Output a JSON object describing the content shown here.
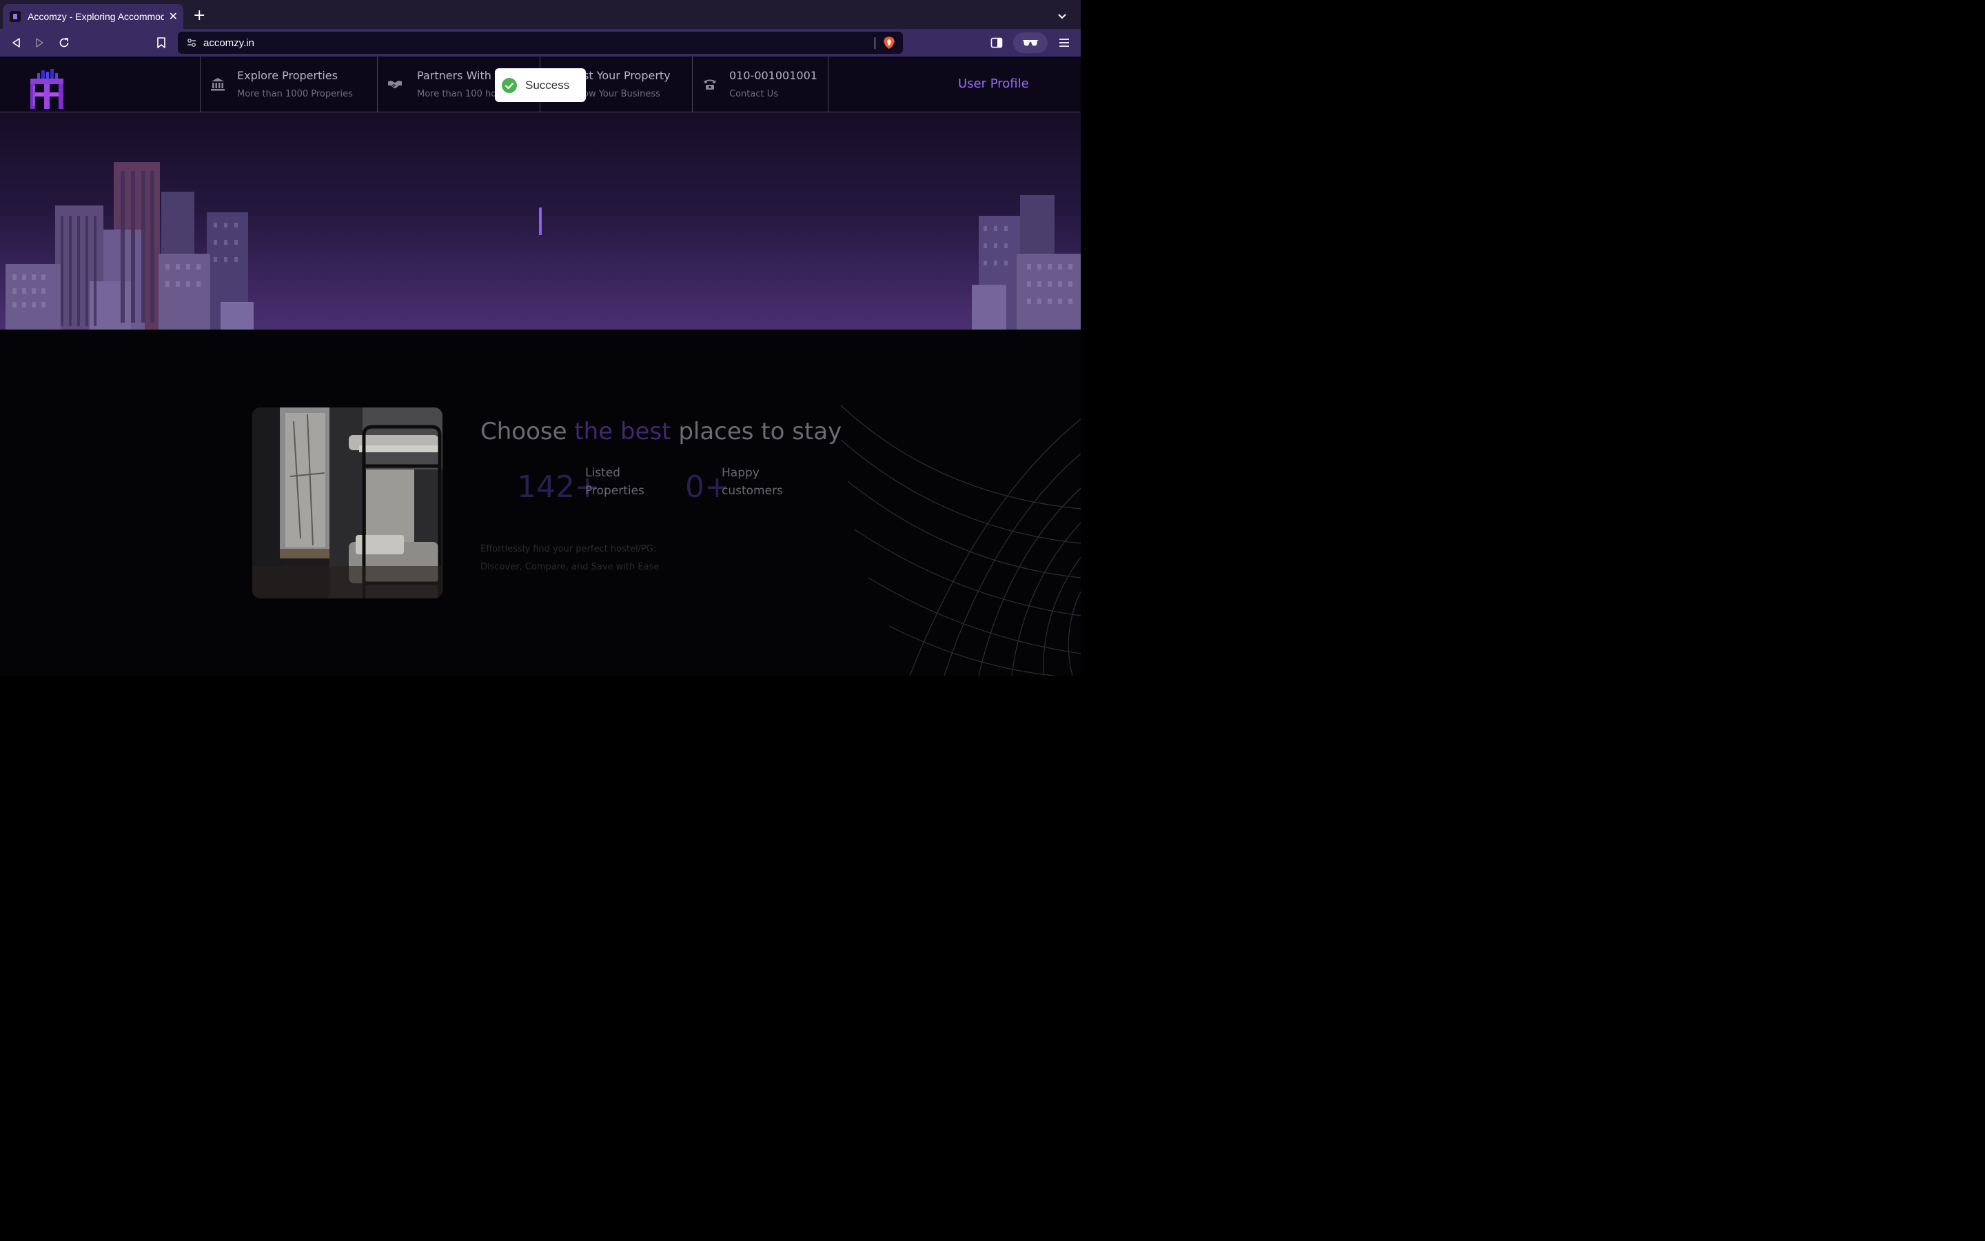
{
  "browser": {
    "tab_title": "Accomzy - Exploring Accommodations",
    "url": "accomzy.in"
  },
  "header": {
    "nav": [
      {
        "title": "Explore Properties",
        "subtitle": "More than 1000 Properies"
      },
      {
        "title": "Partners With",
        "subtitle": "More than 100 ho"
      },
      {
        "title": "st Your Property",
        "subtitle": "ow Your Business"
      },
      {
        "title": "010-001001001",
        "subtitle": "Contact Us"
      }
    ],
    "user_profile": "User Profile"
  },
  "toast": {
    "message": "Success",
    "status_color": "#4caf50"
  },
  "main": {
    "headline_pre": "Choose",
    "headline_highlight": "the best",
    "headline_post": "places to stay",
    "stats": [
      {
        "value": "142+",
        "label_line1": "Listed",
        "label_line2": "Properties"
      },
      {
        "value": "0+",
        "label_line1": "Happy",
        "label_line2": "customers"
      }
    ],
    "tagline": "Effortlessly find your perfect hostel/PG: Discover, Compare, and Save with Ease"
  },
  "colors": {
    "accent": "#9a6cf6",
    "chrome_tab": "#3a2b63",
    "chrome_bg": "#201b31"
  },
  "icons": [
    "back-icon",
    "forward-icon",
    "reload-icon",
    "bookmark-icon",
    "site-settings-icon",
    "brave-shield-icon",
    "sidebar-icon",
    "glasses-icon",
    "menu-icon",
    "bank-icon",
    "handshake-icon",
    "phone-icon",
    "check-circle-icon"
  ]
}
